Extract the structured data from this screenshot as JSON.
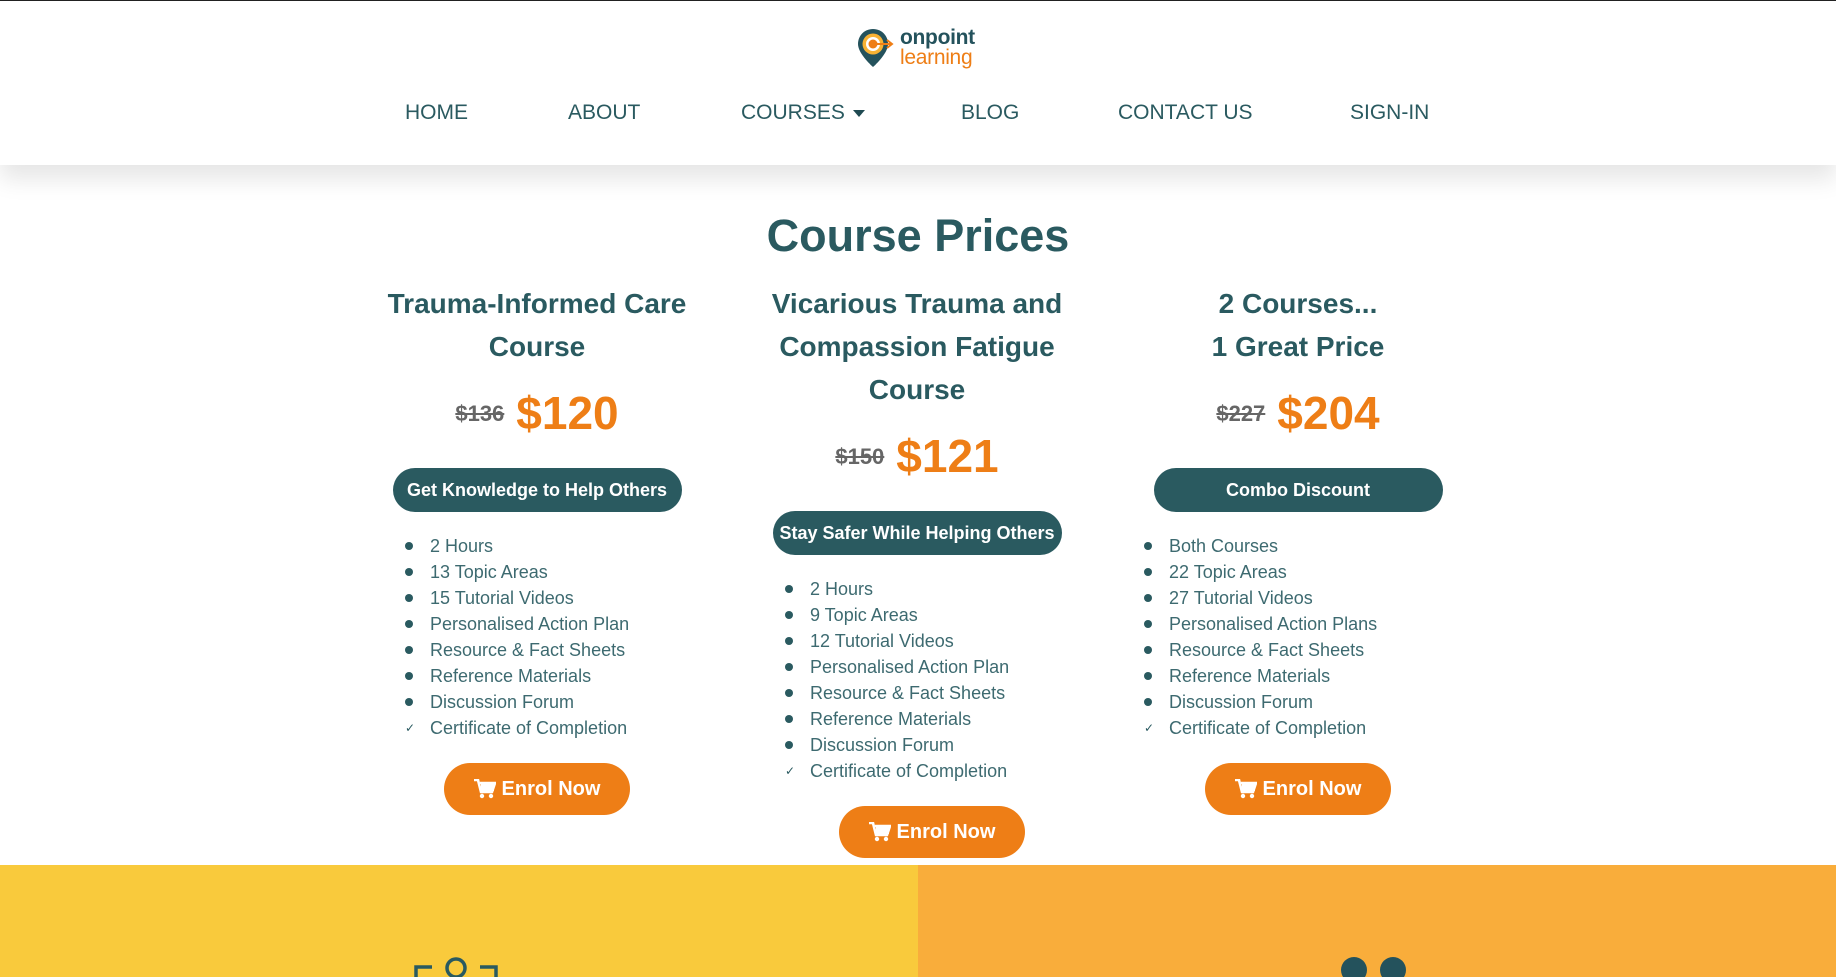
{
  "brand": {
    "name_line1": "onpoint",
    "name_line2": "learning"
  },
  "nav": {
    "home": "HOME",
    "about": "ABOUT",
    "courses": "COURSES",
    "blog": "BLOG",
    "contact": "CONTACT US",
    "signin": "SIGN-IN"
  },
  "section": {
    "title": "Course Prices"
  },
  "courses": [
    {
      "title_lines": [
        "Trauma-Informed Care",
        "Course"
      ],
      "old_price": "$136",
      "new_price": "$120",
      "tag": "Get Knowledge to Help Others",
      "features": [
        "2 Hours",
        "13 Topic Areas",
        "15 Tutorial Videos",
        "Personalised Action Plan",
        "Resource & Fact Sheets",
        "Reference Materials",
        "Discussion Forum"
      ],
      "check_feature": "Certificate of Completion",
      "enrol": "Enrol Now"
    },
    {
      "title_lines": [
        "Vicarious Trauma and",
        "Compassion Fatigue",
        "Course"
      ],
      "old_price": "$150",
      "new_price": "$121",
      "tag": "Stay Safer While Helping Others",
      "features": [
        "2 Hours",
        "9 Topic Areas",
        "12 Tutorial Videos",
        "Personalised Action Plan",
        "Resource & Fact Sheets",
        "Reference Materials",
        "Discussion Forum"
      ],
      "check_feature": "Certificate of Completion",
      "enrol": "Enrol Now"
    },
    {
      "title_lines": [
        "2 Courses...",
        "1 Great Price"
      ],
      "old_price": "$227",
      "new_price": "$204",
      "tag": "Combo Discount",
      "features": [
        "Both Courses",
        "22 Topic Areas",
        "27 Tutorial Videos",
        "Personalised Action Plans",
        "Resource & Fact Sheets",
        "Reference Materials",
        "Discussion Forum"
      ],
      "check_feature": "Certificate of Completion",
      "enrol": "Enrol Now"
    }
  ],
  "icons": {
    "logo": "target-pin-icon",
    "cart": "cart-icon",
    "caret": "caret-down-icon",
    "check": "check-icon"
  },
  "colors": {
    "teal": "#2a5a60",
    "orange": "#ee7e16",
    "band_yellow": "#f9ca3c",
    "band_orange": "#f9ad3b"
  }
}
